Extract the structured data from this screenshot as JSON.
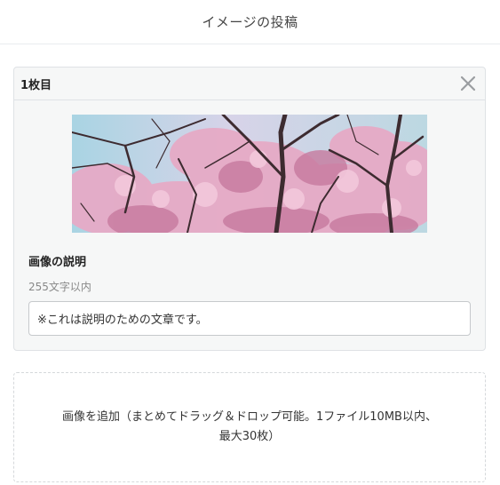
{
  "header": {
    "title": "イメージの投稿"
  },
  "card": {
    "title": "1枚目",
    "close_icon": "close-x-icon",
    "preview": {
      "subject": "cherry-blossom-photo",
      "colors": {
        "sky": "#b9d6e6",
        "blossom": "#e3a6c2",
        "blossom_dark": "#b96a92",
        "branch": "#3c2a2e"
      }
    },
    "description_label": "画像の説明",
    "description_hint": "255文字以内",
    "description_value": "※これは説明のための文章です。"
  },
  "dropzone": {
    "text_line1": "画像を追加（まとめてドラッグ＆ドロップ可能。1ファイル10MB以内、",
    "text_line2": "最大30枚）"
  }
}
